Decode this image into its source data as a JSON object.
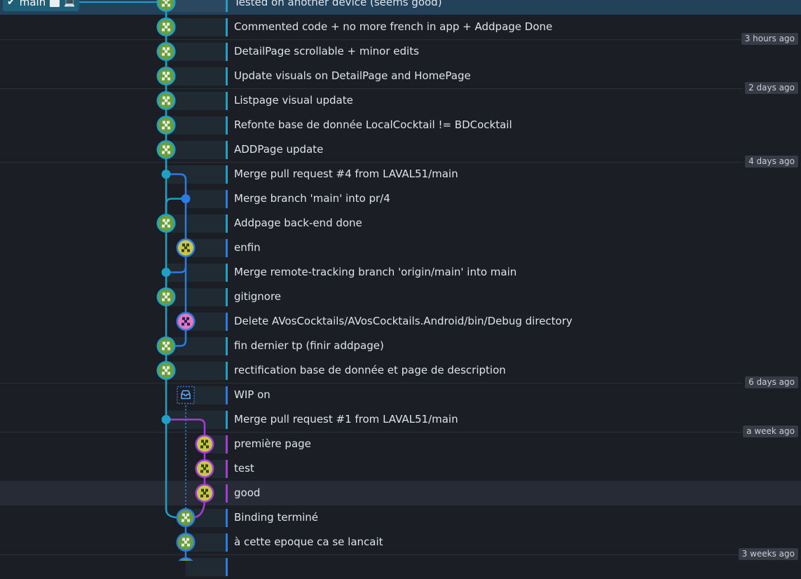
{
  "branch_tag": {
    "check_glyph": "✔",
    "name": "main",
    "laptop_glyph": "💻"
  },
  "colors": {
    "lane_teal": "#1da1c4",
    "lane_blue": "#2a7be6",
    "lane_purple": "#a63bd6",
    "avatar_green": "#6a9f3c",
    "avatar_yellow": "#c7c94b",
    "avatar_pink": "#e37ac0"
  },
  "commits": [
    {
      "message": "Tested on another device (seems good)",
      "lane": 0,
      "color": "teal",
      "type": "avatar",
      "avatar": "green",
      "selected": true
    },
    {
      "message": "Commented code + no more french in app + Addpage Done",
      "lane": 0,
      "color": "teal",
      "type": "avatar",
      "avatar": "green"
    },
    {
      "message": "DetailPage scrollable + minor edits",
      "lane": 0,
      "color": "teal",
      "type": "avatar",
      "avatar": "green"
    },
    {
      "message": "Update visuals on DetailPage and HomePage",
      "lane": 0,
      "color": "teal",
      "type": "avatar",
      "avatar": "green"
    },
    {
      "message": "Listpage visual update",
      "lane": 0,
      "color": "teal",
      "type": "avatar",
      "avatar": "green"
    },
    {
      "message": "Refonte base de donnée LocalCocktail != BDCocktail",
      "lane": 0,
      "color": "teal",
      "type": "avatar",
      "avatar": "green"
    },
    {
      "message": "ADDPage update",
      "lane": 0,
      "color": "teal",
      "type": "avatar",
      "avatar": "green"
    },
    {
      "message": "Merge pull request #4 from LAVAL51/main",
      "lane": 0,
      "color": "teal",
      "type": "merge"
    },
    {
      "message": "Merge branch 'main' into pr/4",
      "lane": 1,
      "color": "blue",
      "type": "merge"
    },
    {
      "message": "Addpage back-end done",
      "lane": 0,
      "color": "teal",
      "type": "avatar",
      "avatar": "green"
    },
    {
      "message": "enfin",
      "lane": 1,
      "color": "blue",
      "type": "avatar",
      "avatar": "yellow"
    },
    {
      "message": "Merge remote-tracking branch 'origin/main' into main",
      "lane": 0,
      "color": "teal",
      "type": "merge"
    },
    {
      "message": "gitignore",
      "lane": 0,
      "color": "teal",
      "type": "avatar",
      "avatar": "green"
    },
    {
      "message": "Delete AVosCocktails/AVosCocktails.Android/bin/Debug directory",
      "lane": 1,
      "color": "blue",
      "type": "avatar",
      "avatar": "pink"
    },
    {
      "message": "fin dernier tp (finir addpage)",
      "lane": 0,
      "color": "teal",
      "type": "avatar",
      "avatar": "green"
    },
    {
      "message": "rectification base de donnée et page de description",
      "lane": 0,
      "color": "teal",
      "type": "avatar",
      "avatar": "green"
    },
    {
      "message": "WIP on",
      "lane": 1,
      "color": "blue",
      "type": "wip"
    },
    {
      "message": "Merge pull request #1 from LAVAL51/main",
      "lane": 0,
      "color": "teal",
      "type": "merge"
    },
    {
      "message": "première page",
      "lane": 2,
      "color": "purple",
      "type": "avatar",
      "avatar": "yellow"
    },
    {
      "message": "test",
      "lane": 2,
      "color": "purple",
      "type": "avatar",
      "avatar": "yellow"
    },
    {
      "message": "good",
      "lane": 2,
      "color": "purple",
      "type": "avatar",
      "avatar": "yellow",
      "hover": true
    },
    {
      "message": "Binding terminé",
      "lane": 1,
      "color": "blue",
      "type": "avatar",
      "avatar": "green"
    },
    {
      "message": "à cette epoque ca se lancait",
      "lane": 1,
      "color": "blue",
      "type": "avatar",
      "avatar": "green"
    },
    {
      "message": "",
      "lane": 1,
      "color": "blue",
      "type": "avatar",
      "avatar": "green"
    }
  ],
  "date_markers": [
    {
      "after_row": 1,
      "label": "3 hours ago"
    },
    {
      "after_row": 3,
      "label": "2 days ago"
    },
    {
      "after_row": 6,
      "label": "4 days ago"
    },
    {
      "after_row": 15,
      "label": "6 days ago"
    },
    {
      "after_row": 17,
      "label": "a week ago"
    },
    {
      "after_row": 22,
      "label": "3 weeks ago"
    }
  ]
}
